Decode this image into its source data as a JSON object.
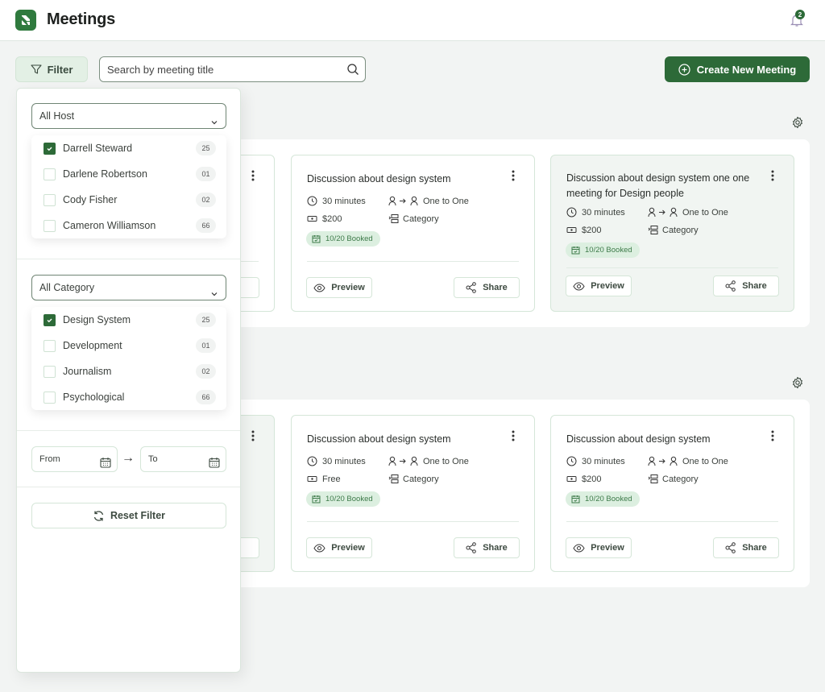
{
  "header": {
    "title": "Meetings",
    "notification_count": "2"
  },
  "toolbar": {
    "filter_label": "Filter",
    "search_placeholder": "Search by meeting title",
    "create_label": "Create New Meeting"
  },
  "colors": {
    "brand": "#2d6a38",
    "badge_bg": "#dcefe0",
    "page_bg": "#f2f4f3"
  },
  "filter_panel": {
    "host_select": "All Host",
    "hosts": [
      {
        "name": "Darrell Steward",
        "count": "25",
        "checked": true
      },
      {
        "name": "Darlene Robertson",
        "count": "01",
        "checked": false
      },
      {
        "name": "Cody Fisher",
        "count": "02",
        "checked": false
      },
      {
        "name": "Cameron Williamson",
        "count": "66",
        "checked": false
      }
    ],
    "category_select": "All Category",
    "categories": [
      {
        "name": "Design System",
        "count": "25",
        "checked": true
      },
      {
        "name": "Development",
        "count": "01",
        "checked": false
      },
      {
        "name": "Journalism",
        "count": "02",
        "checked": false
      },
      {
        "name": "Psychological",
        "count": "66",
        "checked": false
      }
    ],
    "from_placeholder": "From",
    "to_placeholder": "To",
    "arrow": "→",
    "reset_label": "Reset Filter"
  },
  "sections": [
    {
      "partial_card": {
        "share_fragment": "re"
      },
      "cards": [
        {
          "title": "Discussion about design system",
          "duration": "30 minutes",
          "price": "$200",
          "type": "One to One",
          "category": "Category",
          "booked": "10/20 Booked",
          "preview": "Preview",
          "share": "Share"
        },
        {
          "title": "Discussion about design system one one meeting for Design people",
          "duration": "30 minutes",
          "price": "$200",
          "type": "One to One",
          "category": "Category",
          "booked": "10/20 Booked",
          "preview": "Preview",
          "share": "Share",
          "highlighted": true
        }
      ]
    },
    {
      "partial_card": {
        "share_fragment": "re"
      },
      "cards": [
        {
          "title": "Discussion about design system",
          "duration": "30 minutes",
          "price": "Free",
          "type": "One to One",
          "category": "Category",
          "booked": "10/20 Booked",
          "preview": "Preview",
          "share": "Share"
        },
        {
          "title": "Discussion about design system",
          "duration": "30 minutes",
          "price": "$200",
          "type": "One to One",
          "category": "Category",
          "booked": "10/20 Booked",
          "preview": "Preview",
          "share": "Share"
        }
      ]
    }
  ]
}
